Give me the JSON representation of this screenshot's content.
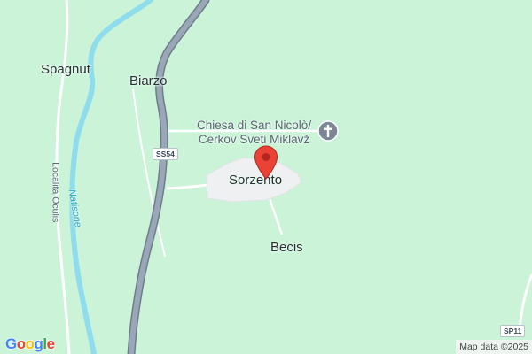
{
  "map": {
    "places": {
      "spagnut": "Spagnut",
      "biarzo": "Biarzo",
      "sorzento": "Sorzento",
      "becis": "Becis"
    },
    "poi": {
      "church_line1": "Chiesa di San Nicolò/",
      "church_line2": "Cerkov Sveti Miklavž",
      "church_icon": "cross-place-of-worship-icon"
    },
    "streets": {
      "oculis": "Località Oculis"
    },
    "water": {
      "natisone": "Natisone"
    },
    "road_shields": {
      "ss54": "SS54",
      "sp11": "SP11"
    },
    "marker": {
      "icon": "location-pin-icon",
      "color": "#ea4335"
    },
    "branding": {
      "logo_letters": [
        "G",
        "o",
        "o",
        "g",
        "l",
        "e"
      ],
      "logo_colors": [
        "#4285f4",
        "#ea4335",
        "#fbbc05",
        "#4285f4",
        "#34a853",
        "#ea4335"
      ],
      "attribution": "Map data ©2025"
    },
    "colors": {
      "land": "#caf3d8",
      "river": "#8fdcec",
      "highway": "#8d9aab",
      "road": "#ffffff",
      "settlement": "#eef0f1"
    }
  }
}
